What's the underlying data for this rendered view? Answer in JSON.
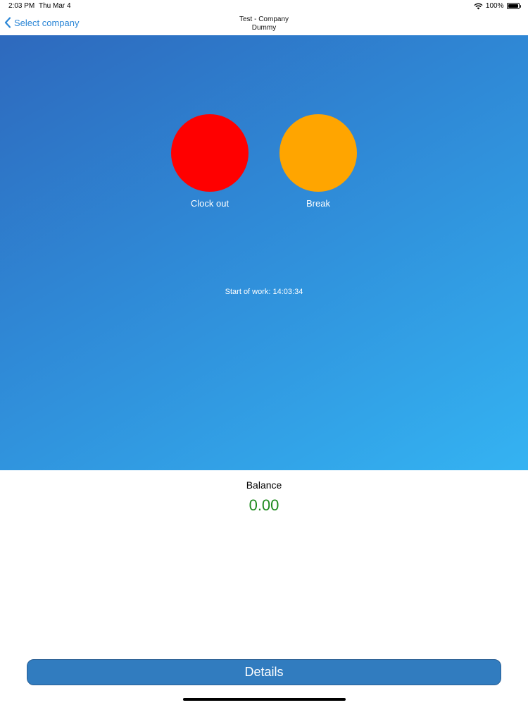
{
  "status_bar": {
    "time": "2:03 PM",
    "date": "Thu Mar 4",
    "battery": "100%",
    "icons": [
      "wifi-icon",
      "battery-icon"
    ]
  },
  "nav": {
    "back_label": "Select company",
    "back_icon": "chevron-left-icon",
    "title_line1": "Test - Company",
    "title_line2": "Dummy",
    "accent_color": "#2b86d6"
  },
  "actions": {
    "clock_out_label": "Clock out",
    "clock_out_color": "#ff0000",
    "break_label": "Break",
    "break_color": "#ffa500"
  },
  "start_of_work": "Start of work: 14:03:34",
  "balance": {
    "label": "Balance",
    "value": "0.00",
    "value_color": "#1e8a1e"
  },
  "details_button_label": "Details"
}
